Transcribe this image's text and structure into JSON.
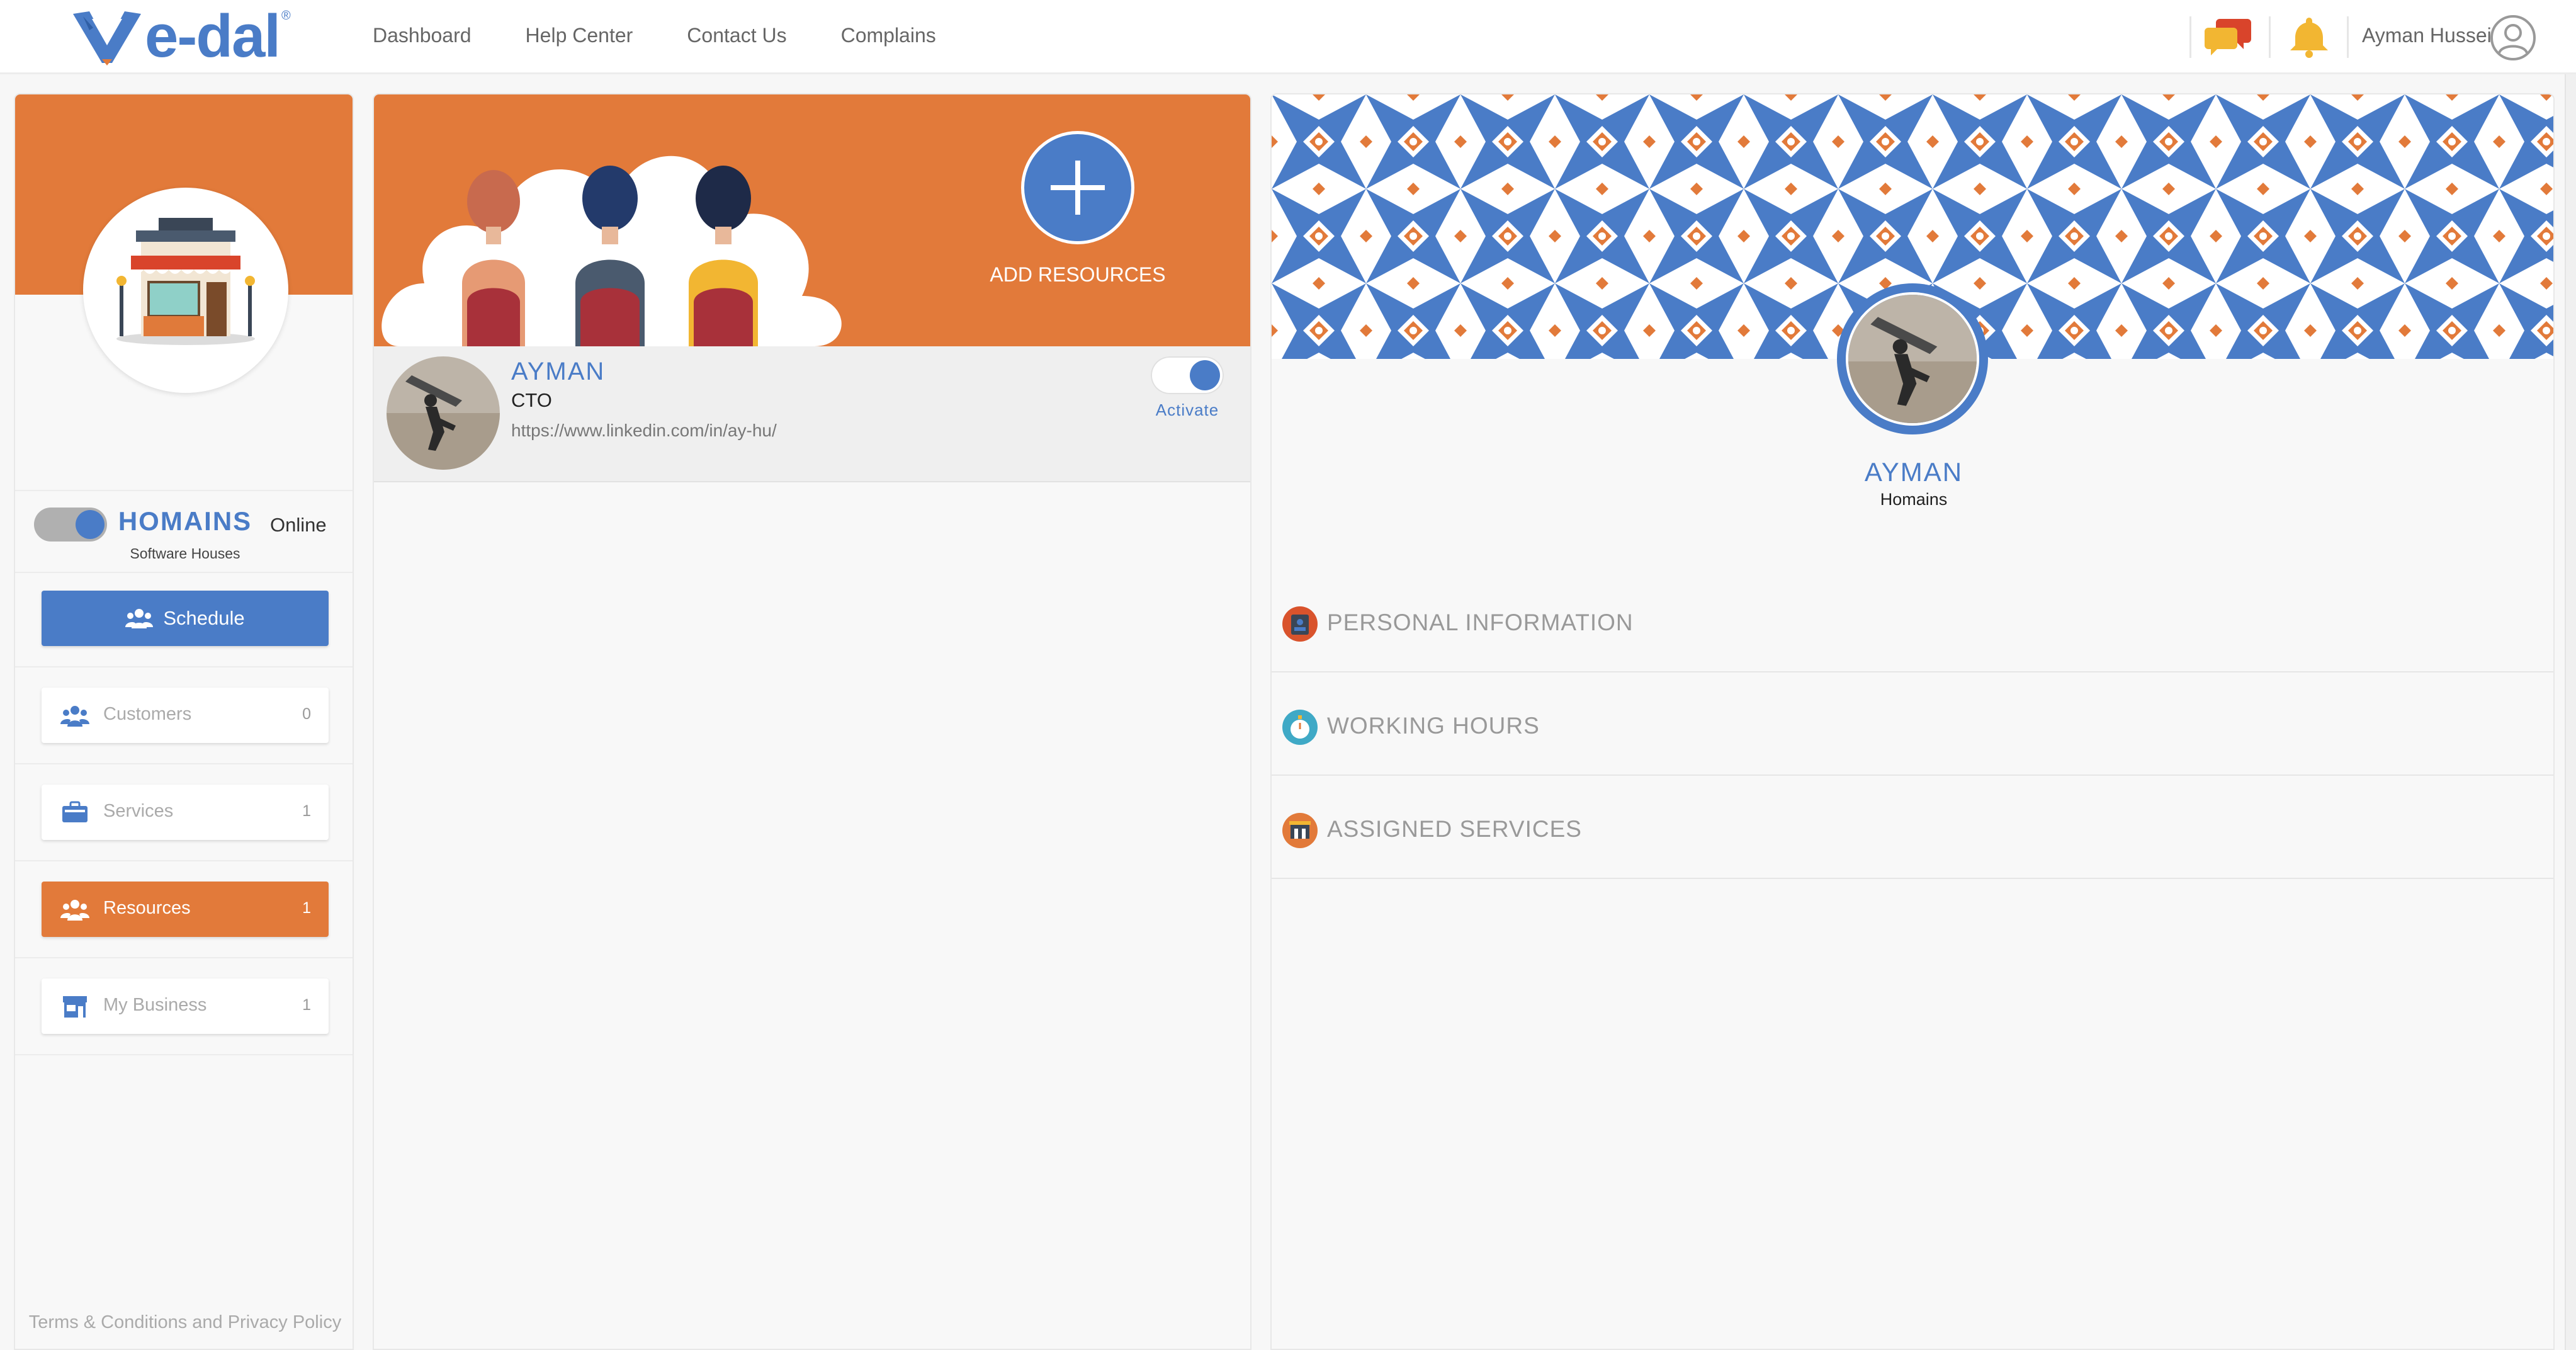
{
  "header": {
    "logo_text": "e-dal",
    "logo_reg": "®",
    "nav": [
      "Dashboard",
      "Help Center",
      "Contact Us",
      "Complains"
    ],
    "user_name": "Ayman Hussein",
    "icons": [
      "chat-icon",
      "bell-icon",
      "user-avatar-icon"
    ]
  },
  "sidebar": {
    "business_name": "HOMAINS",
    "business_category": "Software Houses",
    "status_label": "Online",
    "schedule_label": "Schedule",
    "items": [
      {
        "label": "Customers",
        "count": "0",
        "icon": "customers-icon",
        "active": false
      },
      {
        "label": "Services",
        "count": "1",
        "icon": "briefcase-icon",
        "active": false
      },
      {
        "label": "Resources",
        "count": "1",
        "icon": "people-icon",
        "active": true
      },
      {
        "label": "My Business",
        "count": "1",
        "icon": "store-icon",
        "active": false
      }
    ],
    "terms": "Terms & Conditions and Privacy Policy"
  },
  "resources": {
    "add_label": "ADD RESOURCES",
    "list": [
      {
        "name": "AYMAN",
        "title": "CTO",
        "link": "https://www.linkedin.com/in/ay-hu/",
        "activate_label": "Activate",
        "active": true
      }
    ]
  },
  "profile": {
    "name": "AYMAN",
    "organization": "Homains",
    "sections": [
      {
        "label": "PERSONAL INFORMATION",
        "icon": "id-badge-icon",
        "color": "#d9532c"
      },
      {
        "label": "WORKING HOURS",
        "icon": "stopwatch-icon",
        "color": "#3fa9c6"
      },
      {
        "label": "ASSIGNED SERVICES",
        "icon": "services-icon",
        "color": "#e27a3a"
      }
    ]
  },
  "colors": {
    "brand_blue": "#4a7cc7",
    "brand_orange": "#e27a3a"
  }
}
